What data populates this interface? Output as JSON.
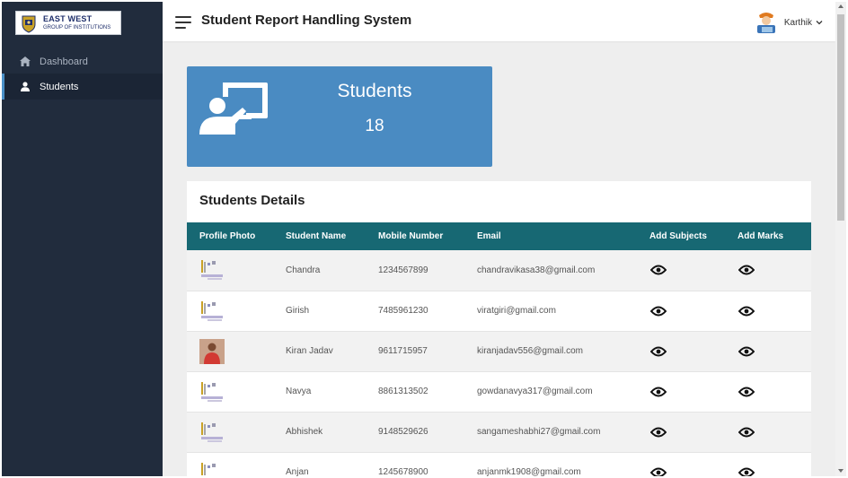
{
  "brand": {
    "line1": "EAST WEST",
    "line2": "GROUP OF INSTITUTIONS"
  },
  "sidebar": {
    "items": [
      {
        "label": "Dashboard",
        "icon": "home-icon",
        "active": false
      },
      {
        "label": "Students",
        "icon": "user-icon",
        "active": true
      }
    ]
  },
  "header": {
    "title": "Student Report Handling System",
    "user_name": "Karthik"
  },
  "stat_card": {
    "title": "Students",
    "value": "18"
  },
  "details": {
    "title": "Students Details",
    "columns": [
      "Profile Photo",
      "Student Name",
      "Mobile Number",
      "Email",
      "Add Subjects",
      "Add Marks"
    ],
    "rows": [
      {
        "name": "Chandra",
        "mobile": "1234567899",
        "email": "chandravikasa38@gmail.com",
        "photo": "logo-placeholder"
      },
      {
        "name": "Girish",
        "mobile": "7485961230",
        "email": "viratgiri@gmail.com",
        "photo": "logo-placeholder"
      },
      {
        "name": "Kiran Jadav",
        "mobile": "9611715957",
        "email": "kiranjadav556@gmail.com",
        "photo": "portrait"
      },
      {
        "name": "Navya",
        "mobile": "8861313502",
        "email": "gowdanavya317@gmail.com",
        "photo": "logo-placeholder"
      },
      {
        "name": "Abhishek",
        "mobile": "9148529626",
        "email": "sangameshabhi27@gmail.com",
        "photo": "logo-placeholder"
      },
      {
        "name": "Anjan",
        "mobile": "1245678900",
        "email": "anjanmk1908@gmail.com",
        "photo": "logo-placeholder"
      }
    ]
  },
  "colors": {
    "sidebar": "#212c3d",
    "accent_card": "#4a8bc2",
    "table_header": "#176873"
  }
}
